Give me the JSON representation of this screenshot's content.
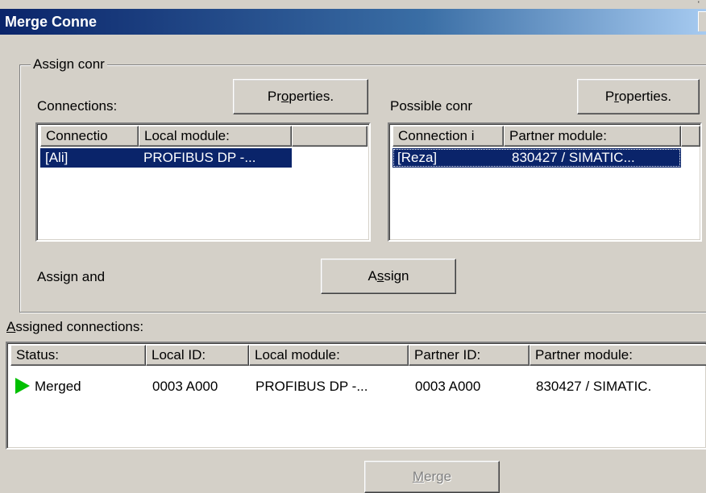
{
  "window": {
    "title": "Merge Conne"
  },
  "group": {
    "label": "Assign conr"
  },
  "left": {
    "label": "Connections:",
    "properties_button": {
      "pre": "Pr",
      "key": "o",
      "post": "perties."
    },
    "columns": [
      "Connectio",
      "Local module:"
    ],
    "rows": [
      {
        "connection": "[Ali]",
        "module": "PROFIBUS DP -..."
      }
    ]
  },
  "right": {
    "label": "Possible conr",
    "properties_button": {
      "pre": "P",
      "key": "r",
      "post": "operties."
    },
    "columns": [
      "Connection i",
      "Partner module:"
    ],
    "rows": [
      {
        "connection": "[Reza]",
        "module": "830427 / SIMATIC..."
      }
    ]
  },
  "assign": {
    "label": "Assign and",
    "button": {
      "pre": "A",
      "key": "s",
      "post": "sign"
    }
  },
  "assigned": {
    "label_key": "A",
    "label_rest": "ssigned connections:",
    "columns": [
      "Status:",
      "Local ID:",
      "Local module:",
      "Partner ID:",
      "Partner module:"
    ],
    "rows": [
      {
        "status_icon": "play-icon",
        "status": "Merged",
        "local_id": "0003 A000",
        "local_module": "PROFIBUS DP -...",
        "partner_id": "0003 A000",
        "partner_module": "830427 / SIMATIC."
      }
    ]
  },
  "merge_button": {
    "key": "M",
    "rest": "erge",
    "enabled": false
  }
}
